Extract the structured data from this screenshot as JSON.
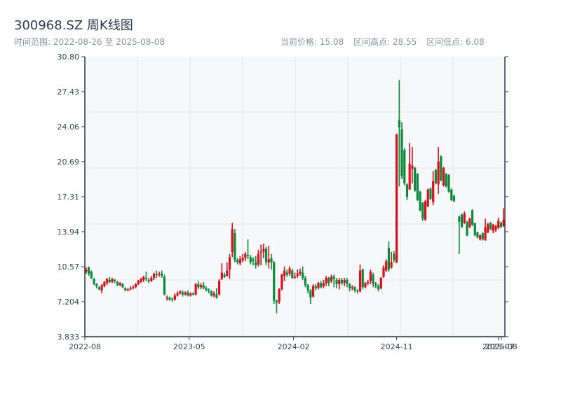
{
  "header": {
    "title": "300968.SZ 周K线图",
    "range_label": "时间范围: 2022-08-26 至 2025-08-08",
    "current_price": "当前价格: 15.08",
    "period_high": "区间高点: 28.55",
    "period_low": "区间低点: 6.08"
  },
  "colors": {
    "up": "#d8101c",
    "down": "#0b8a3a",
    "plot_bg": "#f6f8fa",
    "grid": "#e2e5ea",
    "axis": "#2c3a4b"
  },
  "chart_data": {
    "type": "candlestick",
    "title": "300968.SZ 周K线图",
    "frequency": "weekly",
    "start_date": "2022-08-26",
    "end_date": "2025-08-08",
    "ylim": [
      3.833,
      30.8
    ],
    "y_ticks": [
      "30.80",
      "27.43",
      "24.06",
      "20.69",
      "17.31",
      "13.94",
      "10.57",
      "7.204",
      "3.833"
    ],
    "x_ticks": [
      {
        "label": "2022-08",
        "index": 0
      },
      {
        "label": "2023-05",
        "index": 40
      },
      {
        "label": "2024-02",
        "index": 80
      },
      {
        "label": "2024-11",
        "index": 119.5
      },
      {
        "label": "2025-07",
        "index": 158.5
      },
      {
        "label": "2025-08",
        "index": 159.6
      }
    ],
    "candle_fields": [
      "open",
      "close",
      "low",
      "high"
    ],
    "candles": [
      [
        10.1,
        10.3,
        9.9,
        10.5
      ],
      [
        10.5,
        9.9,
        9.7,
        10.6
      ],
      [
        10.1,
        9.5,
        9.4,
        10.2
      ],
      [
        9.4,
        8.9,
        8.8,
        9.5
      ],
      [
        8.9,
        8.7,
        8.5,
        9.0
      ],
      [
        8.6,
        8.4,
        8.3,
        8.7
      ],
      [
        8.3,
        8.8,
        8.0,
        8.9
      ],
      [
        8.7,
        9.1,
        8.6,
        9.2
      ],
      [
        9.0,
        9.4,
        8.8,
        9.5
      ],
      [
        9.3,
        9.1,
        9.0,
        9.6
      ],
      [
        9.1,
        9.4,
        9.0,
        9.5
      ],
      [
        9.3,
        9.2,
        9.0,
        9.4
      ],
      [
        9.1,
        8.8,
        8.7,
        9.2
      ],
      [
        8.8,
        9.0,
        8.7,
        9.1
      ],
      [
        8.9,
        8.6,
        8.5,
        9.0
      ],
      [
        8.5,
        8.3,
        8.2,
        8.6
      ],
      [
        8.3,
        8.4,
        8.2,
        8.5
      ],
      [
        8.4,
        8.5,
        8.3,
        8.7
      ],
      [
        8.5,
        8.6,
        8.4,
        8.8
      ],
      [
        8.6,
        8.9,
        8.5,
        9.0
      ],
      [
        8.9,
        9.2,
        8.8,
        9.3
      ],
      [
        9.1,
        9.4,
        9.0,
        9.5
      ],
      [
        9.3,
        9.6,
        9.1,
        9.7
      ],
      [
        9.5,
        9.4,
        9.2,
        10.1
      ],
      [
        9.3,
        9.2,
        9.0,
        9.5
      ],
      [
        9.2,
        9.5,
        9.1,
        9.7
      ],
      [
        9.5,
        9.9,
        9.3,
        10.0
      ],
      [
        9.9,
        9.8,
        9.5,
        10.2
      ],
      [
        9.8,
        9.9,
        9.6,
        10.1
      ],
      [
        9.9,
        9.7,
        9.5,
        10.2
      ],
      [
        9.6,
        7.9,
        7.8,
        9.8
      ],
      [
        7.5,
        7.6,
        7.3,
        7.8
      ],
      [
        7.6,
        7.4,
        7.3,
        7.7
      ],
      [
        7.5,
        7.4,
        7.2,
        7.6
      ],
      [
        7.4,
        7.8,
        7.3,
        8.0
      ],
      [
        7.8,
        8.0,
        7.7,
        8.2
      ],
      [
        8.0,
        8.2,
        7.9,
        8.3
      ],
      [
        8.1,
        7.9,
        7.7,
        8.3
      ],
      [
        7.9,
        8.1,
        7.8,
        8.2
      ],
      [
        8.1,
        7.8,
        7.7,
        8.3
      ],
      [
        7.8,
        8.0,
        7.7,
        8.1
      ],
      [
        8.0,
        7.9,
        7.8,
        8.1
      ],
      [
        7.9,
        8.9,
        7.8,
        9.0
      ],
      [
        8.9,
        8.6,
        8.4,
        9.2
      ],
      [
        8.6,
        8.8,
        8.4,
        9.0
      ],
      [
        8.8,
        8.5,
        8.4,
        9.1
      ],
      [
        8.5,
        8.3,
        8.2,
        8.7
      ],
      [
        8.3,
        8.2,
        8.0,
        8.5
      ],
      [
        8.2,
        7.8,
        7.7,
        8.3
      ],
      [
        7.8,
        8.0,
        7.6,
        8.2
      ],
      [
        7.9,
        7.6,
        7.5,
        8.5
      ],
      [
        7.9,
        9.2,
        7.8,
        9.4
      ],
      [
        9.4,
        10.0,
        9.3,
        10.9
      ],
      [
        9.8,
        9.6,
        9.5,
        10.0
      ],
      [
        9.7,
        10.2,
        9.6,
        11.0
      ],
      [
        10.3,
        11.5,
        9.4,
        11.8
      ],
      [
        12.0,
        14.2,
        11.5,
        14.8
      ],
      [
        13.8,
        11.2,
        11.0,
        14.2
      ],
      [
        11.2,
        11.0,
        10.8,
        11.4
      ],
      [
        10.9,
        11.3,
        10.7,
        11.6
      ],
      [
        11.2,
        11.4,
        11.0,
        11.8
      ],
      [
        11.4,
        11.8,
        11.1,
        12.0
      ],
      [
        11.7,
        11.6,
        11.3,
        13.2
      ],
      [
        11.5,
        11.0,
        10.8,
        11.7
      ],
      [
        11.3,
        11.1,
        10.7,
        11.5
      ],
      [
        11.0,
        10.7,
        10.4,
        11.6
      ],
      [
        10.8,
        11.8,
        10.6,
        12.2
      ],
      [
        11.9,
        12.0,
        10.7,
        12.7
      ],
      [
        12.0,
        12.3,
        11.4,
        12.8
      ],
      [
        12.3,
        11.0,
        10.7,
        12.5
      ],
      [
        11.0,
        11.3,
        10.4,
        12.6
      ],
      [
        11.4,
        11.0,
        10.3,
        11.8
      ],
      [
        11.0,
        7.3,
        7.0,
        11.1
      ],
      [
        7.3,
        7.1,
        6.08,
        7.4
      ],
      [
        7.2,
        8.4,
        7.0,
        8.5
      ],
      [
        8.4,
        9.8,
        8.3,
        9.9
      ],
      [
        9.7,
        10.2,
        9.2,
        10.6
      ],
      [
        10.0,
        9.8,
        9.6,
        10.3
      ],
      [
        9.9,
        10.4,
        9.7,
        10.6
      ],
      [
        10.2,
        9.5,
        9.4,
        10.4
      ],
      [
        9.5,
        9.6,
        9.4,
        10.0
      ],
      [
        9.7,
        9.9,
        9.5,
        10.3
      ],
      [
        9.9,
        10.1,
        9.7,
        10.4
      ],
      [
        10.0,
        9.5,
        9.3,
        10.6
      ],
      [
        9.5,
        8.8,
        8.6,
        9.7
      ],
      [
        8.8,
        8.3,
        8.0,
        8.9
      ],
      [
        8.3,
        7.6,
        7.0,
        8.4
      ],
      [
        7.7,
        8.7,
        7.6,
        8.9
      ],
      [
        8.7,
        8.5,
        8.3,
        8.9
      ],
      [
        8.5,
        9.0,
        8.4,
        9.1
      ],
      [
        9.0,
        8.6,
        8.5,
        9.2
      ],
      [
        8.7,
        9.0,
        8.5,
        9.3
      ],
      [
        9.0,
        9.5,
        8.7,
        9.7
      ],
      [
        9.5,
        9.0,
        8.7,
        9.6
      ],
      [
        9.2,
        9.6,
        9.0,
        9.8
      ],
      [
        9.6,
        9.4,
        8.6,
        9.8
      ],
      [
        9.3,
        8.9,
        8.5,
        9.5
      ],
      [
        8.9,
        9.3,
        8.4,
        9.5
      ],
      [
        9.3,
        9.0,
        8.8,
        9.5
      ],
      [
        9.0,
        9.3,
        8.7,
        9.5
      ],
      [
        9.3,
        8.9,
        8.6,
        9.5
      ],
      [
        8.9,
        8.5,
        8.2,
        9.0
      ],
      [
        8.5,
        8.6,
        8.3,
        8.8
      ],
      [
        8.6,
        8.3,
        8.1,
        8.7
      ],
      [
        8.3,
        8.2,
        8.0,
        8.4
      ],
      [
        8.2,
        10.2,
        8.1,
        10.8
      ],
      [
        10.3,
        8.6,
        8.4,
        10.4
      ],
      [
        8.6,
        9.0,
        8.5,
        9.1
      ],
      [
        9.0,
        9.1,
        8.8,
        9.3
      ],
      [
        9.2,
        10.1,
        8.9,
        10.3
      ],
      [
        9.8,
        8.9,
        8.6,
        10.0
      ],
      [
        8.9,
        8.7,
        8.5,
        9.1
      ],
      [
        8.7,
        8.4,
        8.2,
        8.9
      ],
      [
        8.5,
        9.5,
        8.4,
        9.6
      ],
      [
        9.6,
        10.5,
        9.5,
        10.7
      ],
      [
        10.2,
        11.1,
        10.1,
        11.3
      ],
      [
        12.4,
        10.3,
        10.1,
        13.0
      ],
      [
        10.5,
        11.0,
        10.4,
        12.0
      ],
      [
        11.8,
        11.2,
        11.0,
        12.1
      ],
      [
        11.0,
        23.3,
        10.9,
        23.4
      ],
      [
        24.7,
        24.0,
        18.3,
        28.55
      ],
      [
        23.8,
        19.3,
        19.0,
        24.5
      ],
      [
        21.8,
        18.6,
        18.4,
        22.0
      ],
      [
        18.5,
        17.3,
        17.0,
        18.6
      ],
      [
        18.0,
        20.5,
        18.0,
        22.5
      ],
      [
        20.0,
        20.3,
        18.6,
        22.1
      ],
      [
        20.1,
        17.9,
        17.8,
        20.2
      ],
      [
        19.5,
        17.0,
        16.9,
        19.6
      ],
      [
        17.8,
        16.0,
        15.9,
        17.9
      ],
      [
        16.7,
        15.2,
        15.0,
        16.8
      ],
      [
        15.1,
        16.9,
        15.0,
        17.0
      ],
      [
        16.4,
        18.0,
        16.3,
        18.1
      ],
      [
        18.1,
        17.1,
        17.0,
        18.2
      ],
      [
        16.8,
        18.8,
        16.5,
        19.8
      ],
      [
        19.9,
        18.6,
        18.5,
        20.0
      ],
      [
        18.5,
        20.7,
        17.6,
        22.1
      ],
      [
        21.2,
        18.9,
        18.8,
        21.3
      ],
      [
        18.4,
        20.1,
        18.3,
        20.2
      ],
      [
        19.5,
        18.3,
        18.2,
        19.6
      ],
      [
        19.4,
        17.8,
        17.7,
        19.5
      ],
      [
        18.0,
        17.0,
        16.9,
        18.1
      ],
      [
        17.4,
        16.9,
        16.8,
        17.5
      ],
      null,
      [
        15.4,
        14.9,
        11.8,
        15.5
      ],
      [
        15.6,
        14.4,
        14.3,
        15.7
      ],
      [
        14.8,
        15.7,
        14.7,
        15.9
      ],
      [
        14.9,
        13.6,
        13.5,
        15.0
      ],
      [
        14.4,
        15.2,
        14.3,
        15.3
      ],
      [
        16.0,
        14.6,
        14.5,
        16.1
      ],
      [
        14.8,
        13.6,
        13.5,
        14.8
      ],
      [
        13.9,
        13.4,
        13.3,
        13.95
      ],
      [
        13.2,
        13.6,
        13.1,
        13.7
      ],
      [
        13.8,
        13.2,
        13.1,
        13.9
      ],
      [
        13.1,
        14.4,
        13.1,
        15.2
      ],
      [
        13.9,
        14.7,
        13.8,
        14.8
      ],
      [
        14.8,
        14.2,
        14.1,
        14.9
      ],
      [
        14.0,
        14.6,
        13.8,
        14.7
      ],
      [
        14.1,
        14.5,
        13.9,
        14.6
      ],
      [
        14.3,
        15.0,
        14.2,
        15.3
      ],
      [
        14.8,
        14.4,
        14.3,
        14.9
      ],
      [
        14.5,
        15.08,
        14.4,
        16.2
      ]
    ]
  }
}
